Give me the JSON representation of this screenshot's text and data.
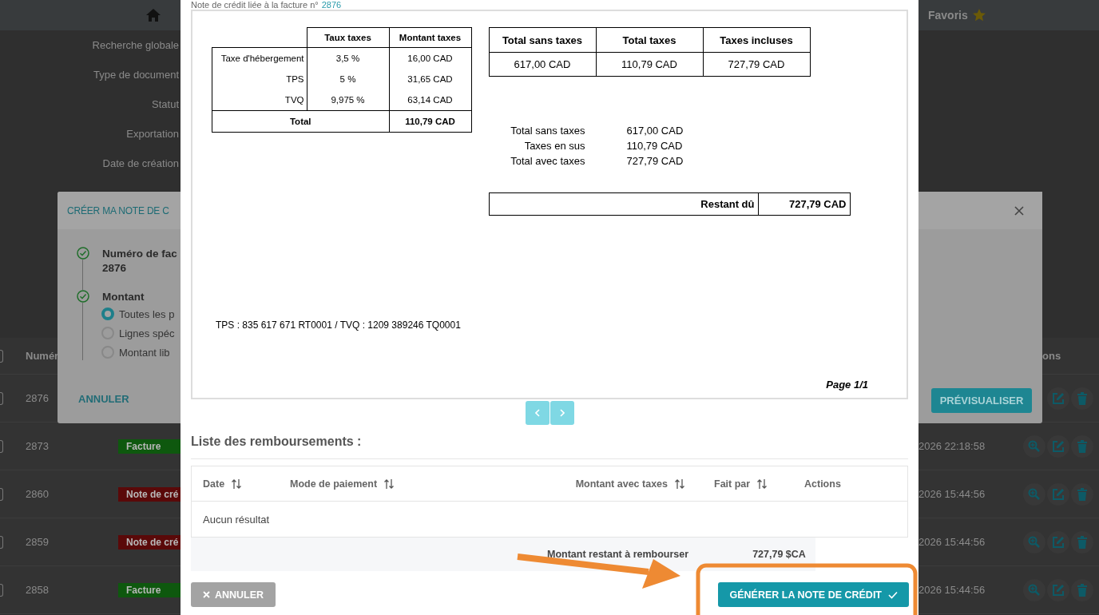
{
  "background_page": {
    "favorites_label": "Favoris",
    "filters": [
      "Recherche globale",
      "Type de document",
      "Statut",
      "Exportation",
      "Date de création"
    ],
    "table": {
      "column_1": "Numér",
      "column_last": "ons",
      "all_checked": false,
      "rows": [
        {
          "number": "2876",
          "checked": false
        },
        {
          "number": "2873",
          "checked": false,
          "badge": {
            "label": "Facture",
            "color": "#0e580e"
          },
          "date": "2026 22:18:58"
        },
        {
          "number": "2860",
          "checked": false,
          "badge": {
            "label": "Note de cré",
            "color": "#5a0909"
          },
          "date": "2026 15:44:56"
        },
        {
          "number": "2859",
          "checked": false,
          "badge": {
            "label": "Note de cré",
            "color": "#5a0909"
          },
          "date": "2026 15:44:56"
        },
        {
          "number": "2858",
          "checked": false,
          "badge": {
            "label": "Facture",
            "color": "#0e580e"
          },
          "date": "2026 15:44:56"
        }
      ]
    }
  },
  "credit_dialog": {
    "title": "CRÉER MA NOTE DE C",
    "steps": [
      {
        "label": "Numéro de fac",
        "value": "2876",
        "done": true
      },
      {
        "label": "Montant",
        "done": true,
        "options": [
          {
            "label": "Toutes les p",
            "selected": true
          },
          {
            "label": "Lignes spéc",
            "selected": false
          },
          {
            "label": "Montant lib",
            "selected": false
          }
        ]
      }
    ],
    "cancel": "ANNULER",
    "preview": "PRÉVISUALISER"
  },
  "preview_modal": {
    "subtitle": "Note de crédit liée à la facture n°",
    "invoice_link": "2876",
    "document": {
      "tax_table": {
        "columns": [
          "Taux taxes",
          "Montant taxes"
        ],
        "rows": [
          {
            "label": "Taxe d'hébergement",
            "rate": "3,5 %",
            "amount": "16,00 CAD"
          },
          {
            "label": "TPS",
            "rate": "5 %",
            "amount": "31,65 CAD"
          },
          {
            "label": "TVQ",
            "rate": "9,975 %",
            "amount": "63,14 CAD"
          }
        ],
        "total": {
          "label": "Total",
          "amount": "110,79 CAD"
        }
      },
      "totals_table": {
        "columns": [
          "Total sans taxes",
          "Total taxes",
          "Taxes incluses"
        ],
        "values": [
          "617,00 CAD",
          "110,79 CAD",
          "727,79 CAD"
        ]
      },
      "summary": [
        {
          "label": "Total sans taxes",
          "value": "617,00 CAD"
        },
        {
          "label": "Taxes en sus",
          "value": "110,79 CAD"
        },
        {
          "label": "Total avec taxes",
          "value": "727,79 CAD"
        }
      ],
      "balance": {
        "label": "Restant dû",
        "value": "727,79 CAD"
      },
      "tax_numbers": "TPS : 835 617 671 RT0001 / TVQ : 1209 389246 TQ0001",
      "page": "Page 1/1"
    },
    "refunds": {
      "title": "Liste des remboursements :",
      "columns": [
        {
          "label": "Date",
          "sortable": true
        },
        {
          "label": "Mode de paiement",
          "sortable": true
        },
        {
          "label": "Montant avec taxes",
          "sortable": true
        },
        {
          "label": "Fait par",
          "sortable": true
        },
        {
          "label": "Actions",
          "sortable": false
        }
      ],
      "empty": "Aucun résultat",
      "footer": {
        "label": "Montant restant à rembourser",
        "value": "727,79 $CA"
      }
    },
    "cancel": "ANNULER",
    "generate": "GÉNÉRER LA NOTE DE CRÉDIT"
  }
}
